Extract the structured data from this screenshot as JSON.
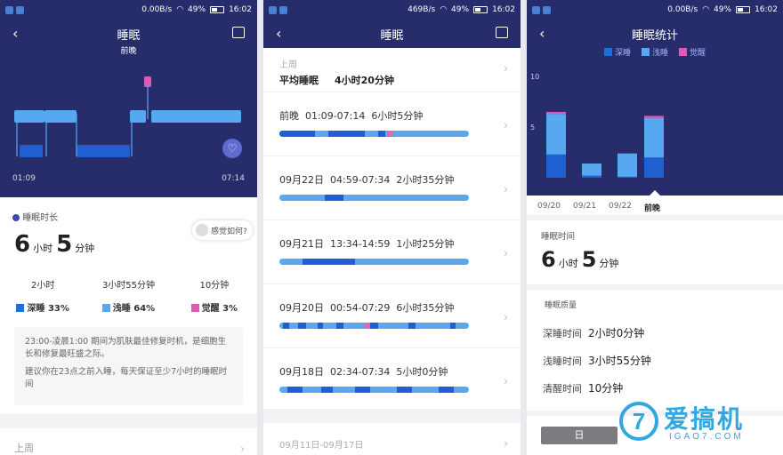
{
  "p1": {
    "status": {
      "speed": "0.00B/s",
      "battery": "49%",
      "time": "16:02"
    },
    "title": "睡眠",
    "subtitle": "前晚",
    "time_start": "01:09",
    "time_end": "07:14",
    "duration_label": "睡眠时长",
    "duration": {
      "hours": "6",
      "h_unit": "小时",
      "minutes": "5",
      "m_unit": "分钟"
    },
    "feeling": "感觉如何?",
    "stages": [
      {
        "time": "2小时",
        "name": "深睡",
        "pct": "33%",
        "color": "#1e6fd9"
      },
      {
        "time": "3小时55分钟",
        "name": "浅睡",
        "pct": "64%",
        "color": "#56a8f0"
      },
      {
        "time": "10分钟",
        "name": "觉醒",
        "pct": "3%",
        "color": "#e059b5"
      }
    ],
    "tip1": "23:00-凌晨1:00 期间为肌肤最佳修复时机，是细胞生长和修复最旺盛之际。",
    "tip2": "建议你在23点之前入睡，每天保证至少7小时的睡眠时间",
    "bottom": "上周"
  },
  "p2": {
    "status": {
      "speed": "469B/s",
      "battery": "49%",
      "time": "16:02"
    },
    "title": "睡眠",
    "week_label": "上周",
    "avg_label": "平均睡眠",
    "avg_value": "4小时20分钟",
    "records": [
      {
        "date": "前晚",
        "range": "01:09-07:14",
        "dur": "6小时5分钟"
      },
      {
        "date": "09月22日",
        "range": "04:59-07:34",
        "dur": "2小时35分钟"
      },
      {
        "date": "09月21日",
        "range": "13:34-14:59",
        "dur": "1小时25分钟"
      },
      {
        "date": "09月20日",
        "range": "00:54-07:29",
        "dur": "6小时35分钟"
      },
      {
        "date": "09月18日",
        "range": "02:34-07:34",
        "dur": "5小时0分钟"
      }
    ],
    "bottom": "09月11日-09月17日"
  },
  "p3": {
    "status": {
      "speed": "0.00B/s",
      "battery": "49%",
      "time": "16:02"
    },
    "title": "睡眠统计",
    "legend": [
      "深睡",
      "浅睡",
      "觉醒"
    ],
    "sleep_time_label": "睡眠时间",
    "duration": {
      "hours": "6",
      "h_unit": "小时",
      "minutes": "5",
      "m_unit": "分钟"
    },
    "quality_label": "睡眠质量",
    "quality": [
      {
        "label": "深睡时间",
        "value": "2小时0分钟"
      },
      {
        "label": "浅睡时间",
        "value": "3小时55分钟"
      },
      {
        "label": "清醒时间",
        "value": "10分钟"
      }
    ],
    "tab_day": "日"
  },
  "chart_data": {
    "type": "bar",
    "categories": [
      "09/20",
      "09/21",
      "09/22",
      "前晚"
    ],
    "series": [
      {
        "name": "深睡",
        "values": [
          2.3,
          0.2,
          0.1,
          2.0
        ]
      },
      {
        "name": "浅睡",
        "values": [
          4.0,
          1.2,
          2.3,
          3.9
        ]
      },
      {
        "name": "觉醒",
        "values": [
          0.2,
          0,
          0,
          0.2
        ]
      }
    ],
    "yticks": [
      "10",
      "5"
    ],
    "ylim": [
      0,
      10
    ],
    "colors": {
      "deep": "#1e5fd1",
      "light": "#56a8f0",
      "awake": "#e059b5"
    }
  },
  "watermark": {
    "brand": "爱搞机",
    "site": "IGAO7.COM"
  }
}
